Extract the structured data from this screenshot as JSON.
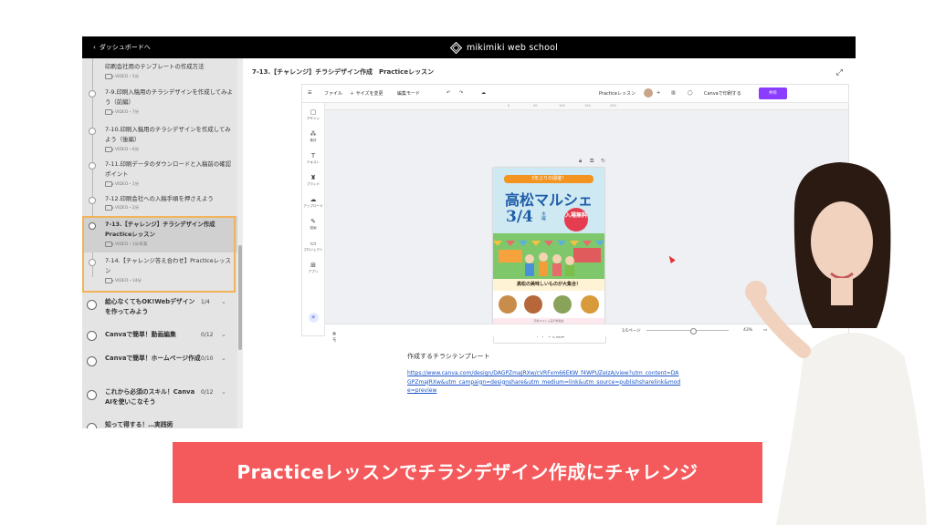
{
  "topbar": {
    "back_label": "ダッシュボードへ",
    "logo_text": "mikimiki web school"
  },
  "sidebar": {
    "lessons": [
      {
        "title": "印刷会社用のテンプレートの作成方法",
        "meta": "VIDEO・5分"
      },
      {
        "title": "7-9.印刷入稿用のチラシデザインを作成してみよう（前編）",
        "meta": "VIDEO・7分"
      },
      {
        "title": "7-10.印刷入稿用のチラシデザインを作成してみよう（後編）",
        "meta": "VIDEO・6分"
      },
      {
        "title": "7-11.印刷データのダウンロードと入稿前の確認ポイント",
        "meta": "VIDEO・1分"
      },
      {
        "title": "7-12.印刷会社への入稿手順を押さえよう",
        "meta": "VIDEO・2分"
      },
      {
        "title": "7-13.【チャレンジ】チラシデザイン作成　Practiceレッスン",
        "meta": "VIDEO・1分未満"
      },
      {
        "title": "7-14.【チャレンジ答え合わせ】Practiceレッスン",
        "meta": "VIDEO・14分"
      }
    ],
    "chapters": [
      {
        "title": "絵心なくてもOK!Webデザインを作ってみよう",
        "progress": "1/4"
      },
      {
        "title": "Canvaで簡単！動画編集",
        "progress": "0/12"
      },
      {
        "title": "Canvaで簡単！ホームページ作成",
        "progress": "0/10"
      },
      {
        "title": "これから必須のスキル！Canva AIを使いこなそう",
        "progress": "0/12"
      },
      {
        "title": "知って得する！…実践術",
        "progress": ""
      }
    ]
  },
  "main": {
    "title": "7-13.【チャレンジ】チラシデザイン作成　Practiceレッスン",
    "section_label": "作成するチラシテンプレート",
    "link": "https://www.canva.com/design/DAGPZmaJRXw/cVRFxm66EKW_f4WPUZeIzA/view?utm_content=DAGPZmaJRXw&utm_campaign=designshare&utm_medium=link&utm_source=publishsharelink&mode=preview"
  },
  "editor": {
    "menu": {
      "file": "ファイル",
      "resize": "＋ サイズを変更",
      "edit_mode": "編集モード",
      "doc_name": "Practiceレッスン",
      "print_label": "Canvaで印刷する",
      "share_label": "共有"
    },
    "tools": [
      "デザイン",
      "素材",
      "テキスト",
      "ブランド",
      "アップロード",
      "描画",
      "プロジェクト",
      "アプリ"
    ],
    "ruler_ticks": [
      "0",
      "50",
      "100",
      "150",
      "200"
    ],
    "flyer": {
      "badge": "3年ぶりの開催！",
      "title": "高松マルシェ",
      "date": "3/4",
      "weekday": "木曜",
      "entry": "入場無料",
      "tagline": "高松の美味しいものが大集合！",
      "footer": "高松マルシェ実行委員会"
    },
    "add_page": "＋ページを追加",
    "bottom": {
      "notes": "メモ",
      "page_info": "1/1ページ",
      "zoom": "43%"
    }
  },
  "banner": {
    "text": "Practiceレッスンでチラシデザイン作成にチャレンジ"
  },
  "colors": {
    "banner": "#f45a5c",
    "highlight": "#f2b35a",
    "canva_purple": "#8b3dff",
    "link": "#1a55c9"
  }
}
